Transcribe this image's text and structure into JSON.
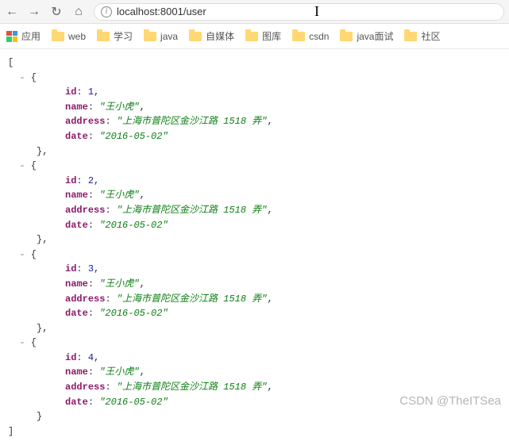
{
  "toolbar": {
    "url": "localhost:8001/user"
  },
  "bookmarks": {
    "apps_label": "应用",
    "items": [
      "web",
      "学习",
      "java",
      "自媒体",
      "图库",
      "csdn",
      "java面试",
      "社区"
    ]
  },
  "json_keys": {
    "id": "id",
    "name": "name",
    "address": "address",
    "date": "date"
  },
  "records": [
    {
      "id": 1,
      "name": "王小虎",
      "address": "上海市普陀区金沙江路 1518 弄",
      "date": "2016-05-02"
    },
    {
      "id": 2,
      "name": "王小虎",
      "address": "上海市普陀区金沙江路 1518 弄",
      "date": "2016-05-02"
    },
    {
      "id": 3,
      "name": "王小虎",
      "address": "上海市普陀区金沙江路 1518 弄",
      "date": "2016-05-02"
    },
    {
      "id": 4,
      "name": "王小虎",
      "address": "上海市普陀区金沙江路 1518 弄",
      "date": "2016-05-02"
    }
  ],
  "watermark": "CSDN @TheITSea"
}
